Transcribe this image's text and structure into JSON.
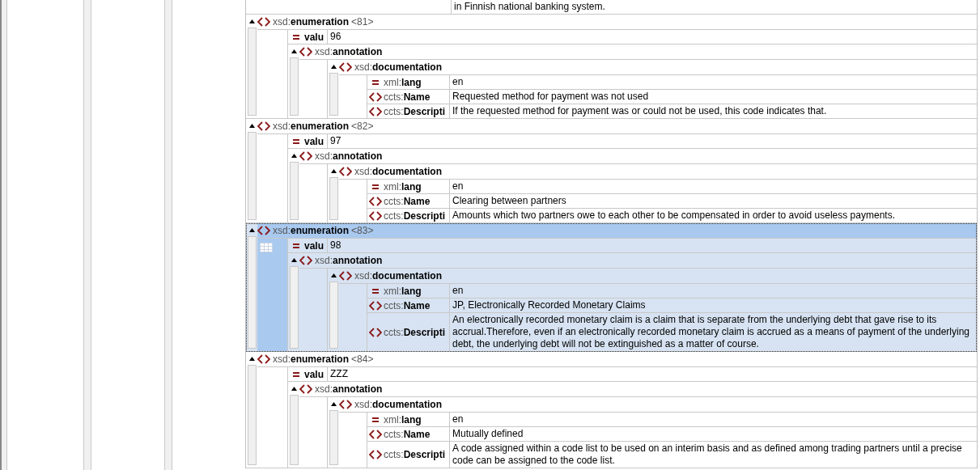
{
  "top_fragment": {
    "value": "in Finnish national banking system."
  },
  "enumerations": [
    {
      "prefix": "xsd:",
      "name": "enumeration",
      "index": "<81>",
      "selected": false,
      "expanded": true,
      "attribute": {
        "name": "valu",
        "value": "96"
      },
      "annotation": {
        "prefix": "xsd:",
        "name": "annotation",
        "expanded": true,
        "documentation": {
          "prefix": "xsd:",
          "name": "documentation",
          "expanded": true,
          "rows": [
            {
              "kind": "attribute",
              "prefix": "xml:",
              "name": "lang",
              "value": "en"
            },
            {
              "kind": "element",
              "prefix": "ccts:",
              "name": "Name",
              "value": "Requested method for payment was not used"
            },
            {
              "kind": "element",
              "prefix": "ccts:",
              "name": "Descripti",
              "value": "If the requested method for payment was or could not be used, this code indicates that."
            }
          ]
        }
      }
    },
    {
      "prefix": "xsd:",
      "name": "enumeration",
      "index": "<82>",
      "selected": false,
      "expanded": true,
      "attribute": {
        "name": "valu",
        "value": "97"
      },
      "annotation": {
        "prefix": "xsd:",
        "name": "annotation",
        "expanded": true,
        "documentation": {
          "prefix": "xsd:",
          "name": "documentation",
          "expanded": true,
          "rows": [
            {
              "kind": "attribute",
              "prefix": "xml:",
              "name": "lang",
              "value": "en"
            },
            {
              "kind": "element",
              "prefix": "ccts:",
              "name": "Name",
              "value": "Clearing between partners"
            },
            {
              "kind": "element",
              "prefix": "ccts:",
              "name": "Descripti",
              "value": "Amounts which two partners owe to each other to be compensated in order to avoid useless payments."
            }
          ]
        }
      }
    },
    {
      "prefix": "xsd:",
      "name": "enumeration",
      "index": "<83>",
      "selected": true,
      "expanded": true,
      "attribute": {
        "name": "valu",
        "value": "98"
      },
      "annotation": {
        "prefix": "xsd:",
        "name": "annotation",
        "expanded": true,
        "documentation": {
          "prefix": "xsd:",
          "name": "documentation",
          "expanded": true,
          "rows": [
            {
              "kind": "attribute",
              "prefix": "xml:",
              "name": "lang",
              "value": "en"
            },
            {
              "kind": "element",
              "prefix": "ccts:",
              "name": "Name",
              "value": "JP, Electronically Recorded Monetary Claims"
            },
            {
              "kind": "element",
              "prefix": "ccts:",
              "name": "Descripti",
              "value": "An electronically recorded monetary claim is a claim that is separate from the underlying debt that gave rise to its accrual.Therefore, even if an electronically recorded monetary claim is accrued as a means of payment of the underlying debt, the underlying debt will not be extinguished as a matter of course."
            }
          ]
        }
      }
    },
    {
      "prefix": "xsd:",
      "name": "enumeration",
      "index": "<84>",
      "selected": false,
      "expanded": true,
      "attribute": {
        "name": "valu",
        "value": "ZZZ"
      },
      "annotation": {
        "prefix": "xsd:",
        "name": "annotation",
        "expanded": true,
        "documentation": {
          "prefix": "xsd:",
          "name": "documentation",
          "expanded": true,
          "rows": [
            {
              "kind": "attribute",
              "prefix": "xml:",
              "name": "lang",
              "value": "en"
            },
            {
              "kind": "element",
              "prefix": "ccts:",
              "name": "Name",
              "value": "Mutually defined"
            },
            {
              "kind": "element",
              "prefix": "ccts:",
              "name": "Descripti",
              "value": "A code assigned within a code list to be used on an interim basis and as defined among trading partners until a precise code can be assigned to the code list."
            }
          ]
        }
      }
    }
  ]
}
